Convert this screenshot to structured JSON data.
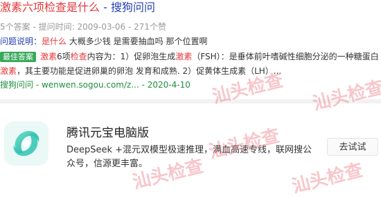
{
  "result": {
    "title_hl": "激素六项检查是什么",
    "title_sep": " - ",
    "title_src": "搜狗问问",
    "meta": "5个答案 - 提问时间: 2009-03-06 - 271个赞",
    "question": {
      "label": "问题说明：",
      "hl": "是什么",
      "text": " 大概多少钱 是需要抽血吗 那个位置啊"
    },
    "answer": {
      "badge": "最佳答案",
      "p1": "激素",
      "p2": "6项",
      "p3": "检查",
      "p4": "内容为：1）促卵泡生成",
      "p5": "激素",
      "p6": "（FSH）：是垂体前叶嗜碱性细胞分泌的一种糖蛋白",
      "p7": "激素",
      "p8": "，其主要功能是促进卵巢的卵泡 发育和成熟. 2）促黄体生成素（LH）..."
    },
    "source": {
      "name": "搜狗问问",
      "url": " - wenwen.sogou.com/z... - 2020-4-10"
    }
  },
  "ad": {
    "title": "腾讯元宝电脑版",
    "desc": "DeepSeek +混元双模型极速推理，满血高速专线，联网搜公众号，信源更丰富。",
    "button": "去试试"
  },
  "watermark": "汕头检查",
  "colors": {
    "link": "#2440b3",
    "highlight": "#e4393c",
    "badge": "#39a85b",
    "source": "#1f8f3f"
  }
}
